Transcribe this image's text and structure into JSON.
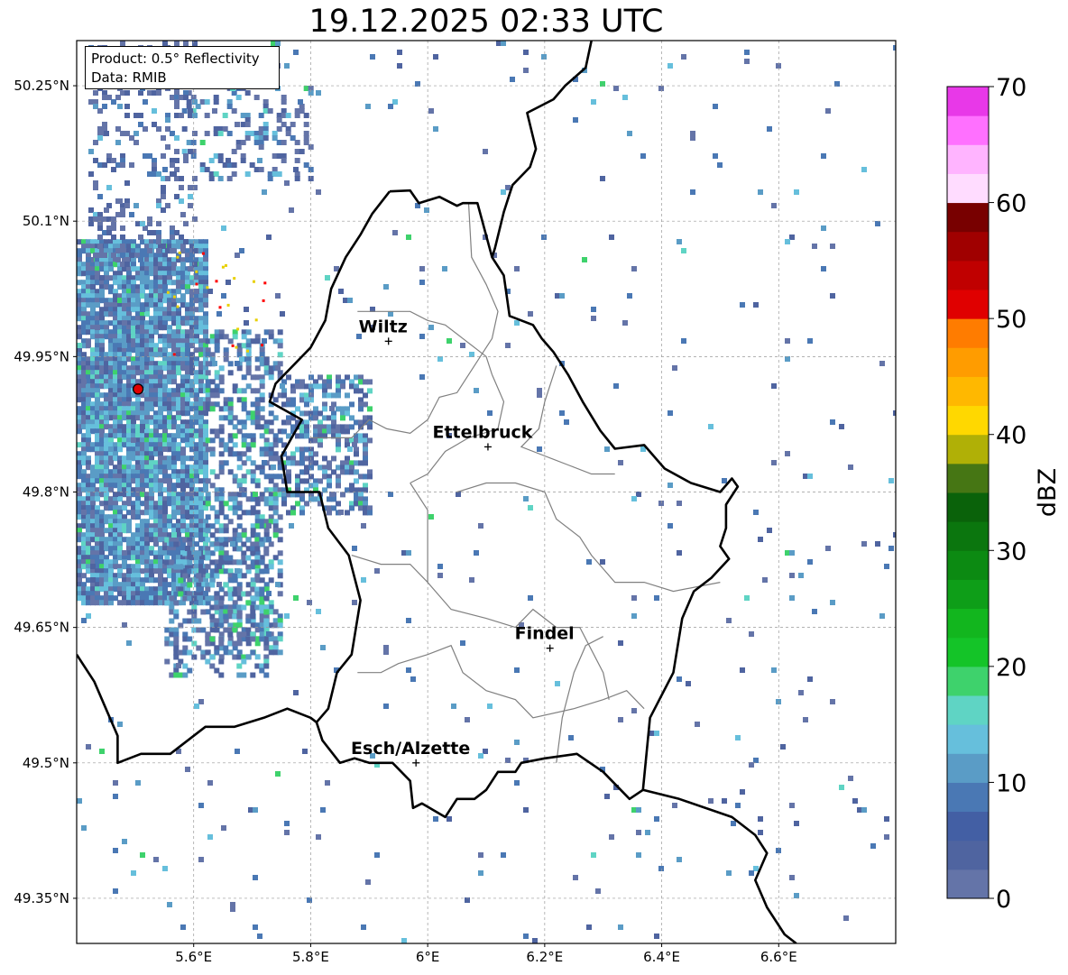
{
  "title": "19.12.2025 02:33 UTC",
  "info": {
    "product": "Product: 0.5° Reflectivity",
    "source": "Data: RMIB"
  },
  "map": {
    "lon_range": [
      5.4,
      6.8
    ],
    "lat_range": [
      49.3,
      50.3
    ],
    "lat_ticks": [
      {
        "value": 50.25,
        "label": "50.25°N"
      },
      {
        "value": 50.1,
        "label": "50.1°N"
      },
      {
        "value": 49.95,
        "label": "49.95°N"
      },
      {
        "value": 49.8,
        "label": "49.8°N"
      },
      {
        "value": 49.65,
        "label": "49.65°N"
      },
      {
        "value": 49.5,
        "label": "49.5°N"
      },
      {
        "value": 49.35,
        "label": "49.35°N"
      }
    ],
    "lon_ticks": [
      {
        "value": 5.6,
        "label": "5.6°E"
      },
      {
        "value": 5.8,
        "label": "5.8°E"
      },
      {
        "value": 6.0,
        "label": "6°E"
      },
      {
        "value": 6.2,
        "label": "6.2°E"
      },
      {
        "value": 6.4,
        "label": "6.4°E"
      },
      {
        "value": 6.6,
        "label": "6.6°E"
      }
    ],
    "grid": true,
    "radar_site": {
      "lon": 5.505,
      "lat": 49.914,
      "color": "#e00000"
    },
    "cities": [
      {
        "name": "Wiltz",
        "lon": 5.933,
        "lat": 49.967
      },
      {
        "name": "Ettelbruck",
        "lon": 6.103,
        "lat": 49.85
      },
      {
        "name": "Findel",
        "lon": 6.209,
        "lat": 49.627
      },
      {
        "name": "Esch/Alzette",
        "lon": 5.98,
        "lat": 49.5
      }
    ],
    "luxembourg_border": [
      [
        5.935,
        50.133
      ],
      [
        5.97,
        50.134
      ],
      [
        5.985,
        50.12
      ],
      [
        6.02,
        50.127
      ],
      [
        6.05,
        50.117
      ],
      [
        6.06,
        50.12
      ],
      [
        6.085,
        50.12
      ],
      [
        6.11,
        50.06
      ],
      [
        6.13,
        50.04
      ],
      [
        6.14,
        49.995
      ],
      [
        6.18,
        49.985
      ],
      [
        6.195,
        49.97
      ],
      [
        6.215,
        49.955
      ],
      [
        6.24,
        49.93
      ],
      [
        6.265,
        49.9
      ],
      [
        6.295,
        49.868
      ],
      [
        6.32,
        49.848
      ],
      [
        6.37,
        49.852
      ],
      [
        6.405,
        49.826
      ],
      [
        6.45,
        49.81
      ],
      [
        6.5,
        49.8
      ],
      [
        6.52,
        49.815
      ],
      [
        6.53,
        49.806
      ],
      [
        6.51,
        49.786
      ],
      [
        6.51,
        49.76
      ],
      [
        6.5,
        49.74
      ],
      [
        6.515,
        49.726
      ],
      [
        6.485,
        49.705
      ],
      [
        6.455,
        49.69
      ],
      [
        6.435,
        49.66
      ],
      [
        6.42,
        49.6
      ],
      [
        6.38,
        49.55
      ],
      [
        6.368,
        49.47
      ],
      [
        6.345,
        49.46
      ],
      [
        6.3,
        49.49
      ],
      [
        6.255,
        49.51
      ],
      [
        6.2,
        49.505
      ],
      [
        6.16,
        49.5
      ],
      [
        6.15,
        49.49
      ],
      [
        6.12,
        49.49
      ],
      [
        6.1,
        49.47
      ],
      [
        6.08,
        49.46
      ],
      [
        6.05,
        49.46
      ],
      [
        6.03,
        49.44
      ],
      [
        5.99,
        49.455
      ],
      [
        5.975,
        49.45
      ],
      [
        5.97,
        49.48
      ],
      [
        5.94,
        49.5
      ],
      [
        5.9,
        49.5
      ],
      [
        5.875,
        49.505
      ],
      [
        5.85,
        49.5
      ],
      [
        5.82,
        49.525
      ],
      [
        5.81,
        49.545
      ],
      [
        5.83,
        49.56
      ],
      [
        5.845,
        49.6
      ],
      [
        5.87,
        49.62
      ],
      [
        5.885,
        49.68
      ],
      [
        5.865,
        49.73
      ],
      [
        5.83,
        49.76
      ],
      [
        5.815,
        49.8
      ],
      [
        5.76,
        49.8
      ],
      [
        5.75,
        49.84
      ],
      [
        5.785,
        49.88
      ],
      [
        5.73,
        49.9
      ],
      [
        5.74,
        49.92
      ],
      [
        5.8,
        49.96
      ],
      [
        5.825,
        49.99
      ],
      [
        5.835,
        50.025
      ],
      [
        5.86,
        50.06
      ],
      [
        5.885,
        50.085
      ],
      [
        5.905,
        50.108
      ],
      [
        5.935,
        50.133
      ]
    ],
    "germany_border": [
      [
        6.28,
        50.3
      ],
      [
        6.27,
        50.27
      ],
      [
        6.235,
        50.25
      ],
      [
        6.215,
        50.235
      ],
      [
        6.17,
        50.22
      ],
      [
        6.185,
        50.18
      ],
      [
        6.175,
        50.16
      ],
      [
        6.145,
        50.14
      ],
      [
        6.14,
        50.13
      ],
      [
        6.13,
        50.11
      ],
      [
        6.115,
        50.07
      ],
      [
        6.11,
        50.06
      ]
    ],
    "south_border": [
      [
        5.4,
        49.62
      ],
      [
        5.43,
        49.59
      ],
      [
        5.45,
        49.56
      ],
      [
        5.47,
        49.53
      ],
      [
        5.47,
        49.5
      ],
      [
        5.51,
        49.51
      ],
      [
        5.56,
        49.51
      ],
      [
        5.62,
        49.54
      ],
      [
        5.67,
        49.54
      ],
      [
        5.72,
        49.55
      ],
      [
        5.76,
        49.56
      ],
      [
        5.8,
        49.55
      ],
      [
        5.81,
        49.545
      ]
    ],
    "east_border": [
      [
        6.368,
        49.47
      ],
      [
        6.43,
        49.46
      ],
      [
        6.52,
        49.44
      ],
      [
        6.56,
        49.42
      ],
      [
        6.58,
        49.4
      ],
      [
        6.56,
        49.37
      ],
      [
        6.58,
        49.34
      ],
      [
        6.61,
        49.31
      ],
      [
        6.63,
        49.3
      ]
    ],
    "canton_lines": [
      [
        [
          5.88,
          50.0
        ],
        [
          5.93,
          50.0
        ],
        [
          5.97,
          50.0
        ],
        [
          6.0,
          49.99
        ],
        [
          6.03,
          49.985
        ],
        [
          6.06,
          49.97
        ],
        [
          6.1,
          49.95
        ],
        [
          6.11,
          49.93
        ]
      ],
      [
        [
          6.07,
          50.12
        ],
        [
          6.075,
          50.06
        ],
        [
          6.1,
          50.03
        ],
        [
          6.12,
          50.0
        ],
        [
          6.11,
          49.97
        ],
        [
          6.09,
          49.95
        ],
        [
          6.07,
          49.93
        ],
        [
          6.05,
          49.91
        ],
        [
          6.02,
          49.905
        ],
        [
          6.0,
          49.88
        ],
        [
          5.97,
          49.865
        ],
        [
          5.93,
          49.87
        ],
        [
          5.9,
          49.88
        ],
        [
          5.87,
          49.86
        ],
        [
          5.8,
          49.86
        ]
      ],
      [
        [
          6.11,
          49.93
        ],
        [
          6.13,
          49.9
        ],
        [
          6.12,
          49.87
        ],
        [
          6.07,
          49.86
        ],
        [
          6.03,
          49.845
        ],
        [
          6.0,
          49.82
        ],
        [
          5.97,
          49.81
        ]
      ],
      [
        [
          6.22,
          49.94
        ],
        [
          6.2,
          49.9
        ],
        [
          6.19,
          49.87
        ],
        [
          6.16,
          49.85
        ],
        [
          6.2,
          49.84
        ],
        [
          6.24,
          49.83
        ],
        [
          6.28,
          49.82
        ],
        [
          6.32,
          49.82
        ]
      ],
      [
        [
          6.05,
          49.8
        ],
        [
          6.1,
          49.81
        ],
        [
          6.15,
          49.81
        ],
        [
          6.2,
          49.8
        ],
        [
          6.22,
          49.77
        ],
        [
          6.26,
          49.75
        ],
        [
          6.28,
          49.73
        ],
        [
          6.32,
          49.7
        ],
        [
          6.37,
          49.7
        ],
        [
          6.42,
          49.69
        ],
        [
          6.5,
          49.7
        ]
      ],
      [
        [
          5.97,
          49.81
        ],
        [
          6.0,
          49.78
        ],
        [
          6.0,
          49.73
        ],
        [
          6.0,
          49.7
        ],
        [
          6.04,
          49.67
        ],
        [
          6.1,
          49.66
        ],
        [
          6.15,
          49.65
        ],
        [
          6.18,
          49.67
        ],
        [
          6.22,
          49.65
        ],
        [
          6.26,
          49.65
        ],
        [
          6.3,
          49.6
        ],
        [
          6.31,
          49.57
        ]
      ],
      [
        [
          5.87,
          49.73
        ],
        [
          5.92,
          49.72
        ],
        [
          5.97,
          49.72
        ],
        [
          6.0,
          49.7
        ]
      ],
      [
        [
          5.88,
          49.6
        ],
        [
          5.92,
          49.6
        ],
        [
          5.95,
          49.61
        ],
        [
          6.0,
          49.62
        ],
        [
          6.04,
          49.63
        ],
        [
          6.06,
          49.6
        ],
        [
          6.1,
          49.58
        ],
        [
          6.15,
          49.57
        ],
        [
          6.18,
          49.55
        ],
        [
          6.25,
          49.56
        ],
        [
          6.3,
          49.57
        ],
        [
          6.34,
          49.58
        ],
        [
          6.37,
          49.56
        ]
      ],
      [
        [
          6.22,
          49.5
        ],
        [
          6.23,
          49.55
        ],
        [
          6.25,
          49.6
        ],
        [
          6.27,
          49.63
        ],
        [
          6.3,
          49.64
        ]
      ]
    ],
    "blob_palette": [
      "#6474a8",
      "#4f64a0",
      "#4a78b4",
      "#5a9cc6",
      "#66bfdc",
      "#5fd4c4",
      "#3ed26c",
      "#14c428",
      "#0e9e18",
      "#ff0000",
      "#e8d000"
    ],
    "echo_regions": [
      {
        "lon": [
          5.4,
          5.62
        ],
        "lat": [
          49.68,
          50.08
        ],
        "density": 0.88,
        "mix": [
          0.18,
          0.14,
          0.2,
          0.26,
          0.16,
          0.04,
          0.02
        ]
      },
      {
        "lon": [
          5.62,
          5.75
        ],
        "lat": [
          49.62,
          49.98
        ],
        "density": 0.45,
        "mix": [
          0.25,
          0.2,
          0.2,
          0.15,
          0.1,
          0.05,
          0.05
        ]
      },
      {
        "lon": [
          5.75,
          5.9
        ],
        "lat": [
          49.78,
          49.93
        ],
        "density": 0.45,
        "mix": [
          0.25,
          0.2,
          0.2,
          0.15,
          0.1,
          0.05,
          0.05
        ]
      },
      {
        "lon": [
          5.55,
          5.72
        ],
        "lat": [
          49.6,
          49.75
        ],
        "density": 0.35,
        "mix": [
          0.3,
          0.2,
          0.15,
          0.15,
          0.1,
          0.05,
          0.05
        ]
      },
      {
        "lon": [
          5.58,
          5.8
        ],
        "lat": [
          50.15,
          50.25
        ],
        "density": 0.22,
        "mix": [
          0.35,
          0.25,
          0.15,
          0.1,
          0.1,
          0.03,
          0.02
        ]
      },
      {
        "lon": [
          5.42,
          5.6
        ],
        "lat": [
          50.05,
          50.3
        ],
        "density": 0.2,
        "mix": [
          0.5,
          0.3,
          0.1,
          0.05,
          0.05,
          0,
          0
        ]
      },
      {
        "lon": [
          5.4,
          6.8
        ],
        "lat": [
          49.3,
          50.3
        ],
        "density": 0.012,
        "mix": [
          0.3,
          0.2,
          0.2,
          0.15,
          0.1,
          0.03,
          0.02
        ]
      }
    ]
  },
  "colorbar": {
    "label": "dBZ",
    "min": 0,
    "max": 70,
    "step": 2.5,
    "colors": [
      "#6474a8",
      "#4f64a0",
      "#435fa4",
      "#4a78b4",
      "#5a9cc6",
      "#66bfdc",
      "#5fd4c4",
      "#3ed26c",
      "#14c428",
      "#12b61e",
      "#0e9e18",
      "#0c8a12",
      "#0b760e",
      "#0a620a",
      "#467614",
      "#b0b006",
      "#ffd800",
      "#ffb800",
      "#ff9c00",
      "#ff7c00",
      "#e00000",
      "#c00000",
      "#a00000",
      "#780000",
      "#ffdcff",
      "#ffb4ff",
      "#ff70ff",
      "#e838e8"
    ],
    "ticks": [
      {
        "value": 0,
        "label": "0"
      },
      {
        "value": 10,
        "label": "10"
      },
      {
        "value": 20,
        "label": "20"
      },
      {
        "value": 30,
        "label": "30"
      },
      {
        "value": 40,
        "label": "40"
      },
      {
        "value": 50,
        "label": "50"
      },
      {
        "value": 60,
        "label": "60"
      },
      {
        "value": 70,
        "label": "70"
      }
    ]
  }
}
